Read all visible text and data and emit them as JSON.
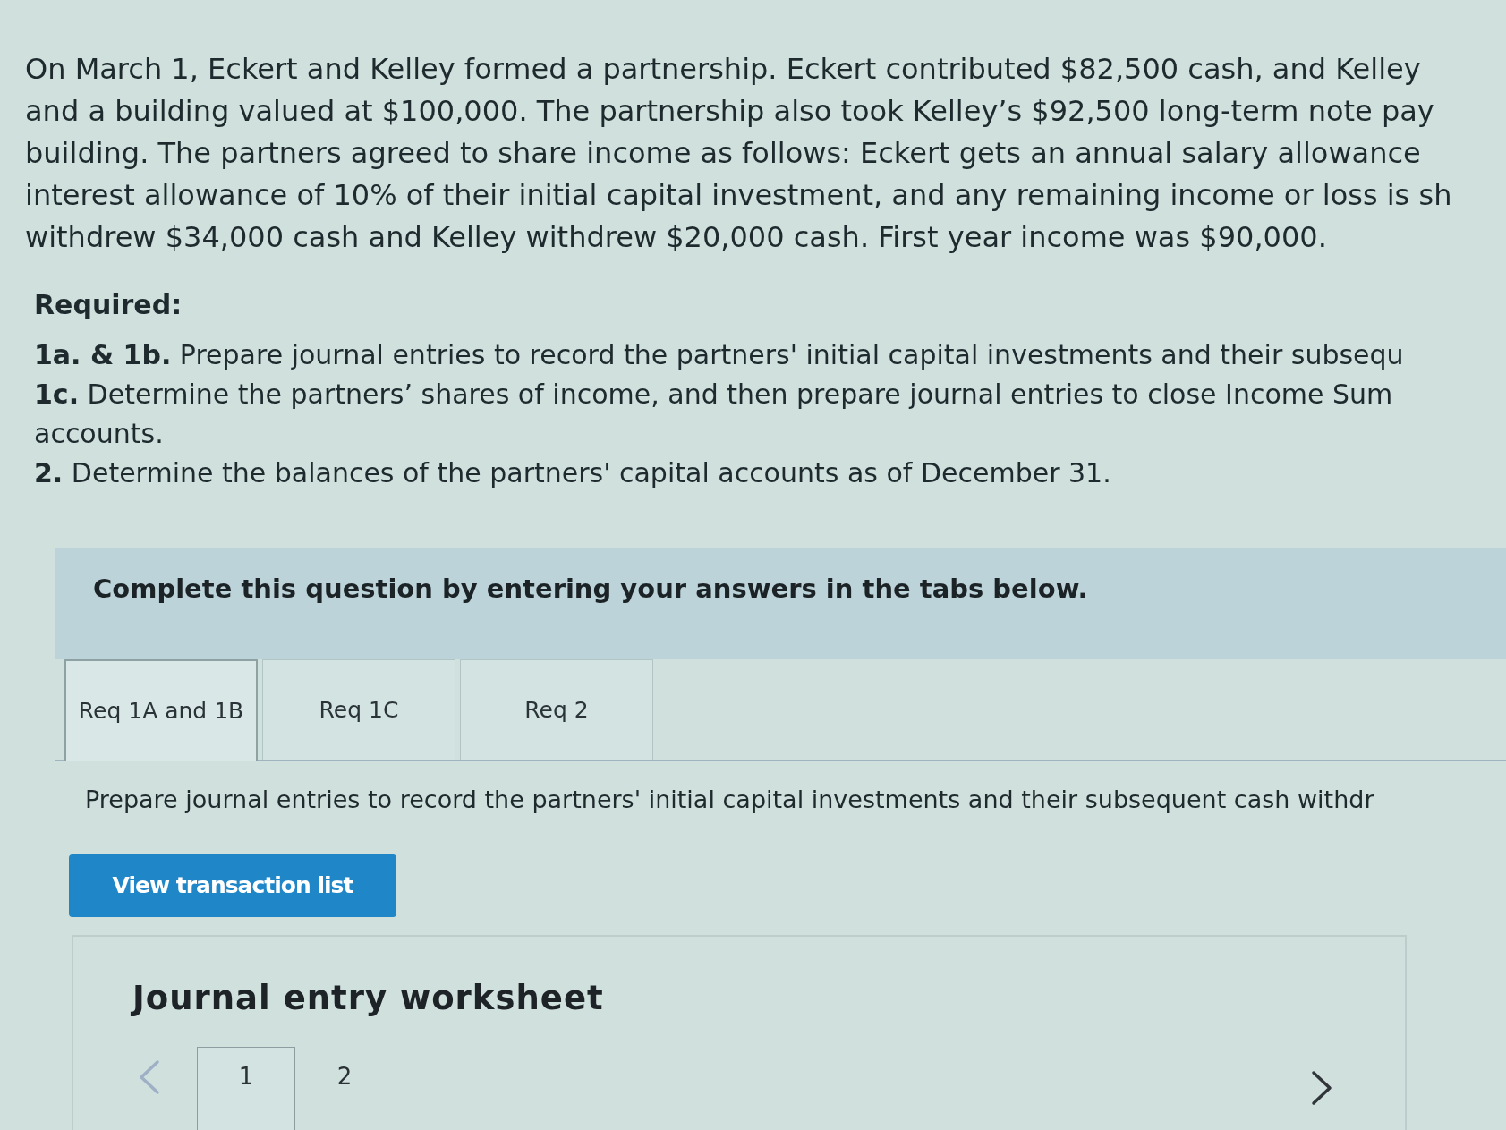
{
  "problem": {
    "lines": [
      "On March 1, Eckert and Kelley formed a partnership. Eckert contributed $82,500 cash, and Kelley",
      "and a building valued at $100,000. The partnership also took Kelley’s $92,500 long-term note pay",
      "building. The partners agreed to share income as follows: Eckert gets an annual salary allowance",
      "interest allowance of 10% of their initial capital investment, and any remaining income or loss is sh",
      "withdrew $34,000 cash and Kelley withdrew $20,000 cash. First year income was $90,000."
    ]
  },
  "required": {
    "heading": "Required:",
    "lines": [
      "**1a. & 1b.** Prepare journal entries to record the partners' initial capital investments and their subsequ",
      "**1c.** Determine the partners’ shares of income, and then prepare journal entries to close Income Sum",
      "accounts.",
      "**2.** Determine the balances of the partners' capital accounts as of December 31."
    ]
  },
  "instruction": "Complete this question by entering your answers in the tabs below.",
  "tabs": [
    {
      "label": "Req 1A and 1B",
      "selected": true
    },
    {
      "label": "Req 1C",
      "selected": false
    },
    {
      "label": "Req 2",
      "selected": false
    }
  ],
  "tab_prompt": "Prepare journal entries to record the partners' initial capital investments and their subsequent cash withdr",
  "view_button": {
    "label": "View transaction list"
  },
  "worksheet": {
    "title": "Journal entry worksheet",
    "prev": {
      "disabled": true
    },
    "pages": [
      {
        "label": "1",
        "selected": true
      },
      {
        "label": "2",
        "selected": false
      }
    ],
    "next": {
      "disabled": false
    }
  }
}
